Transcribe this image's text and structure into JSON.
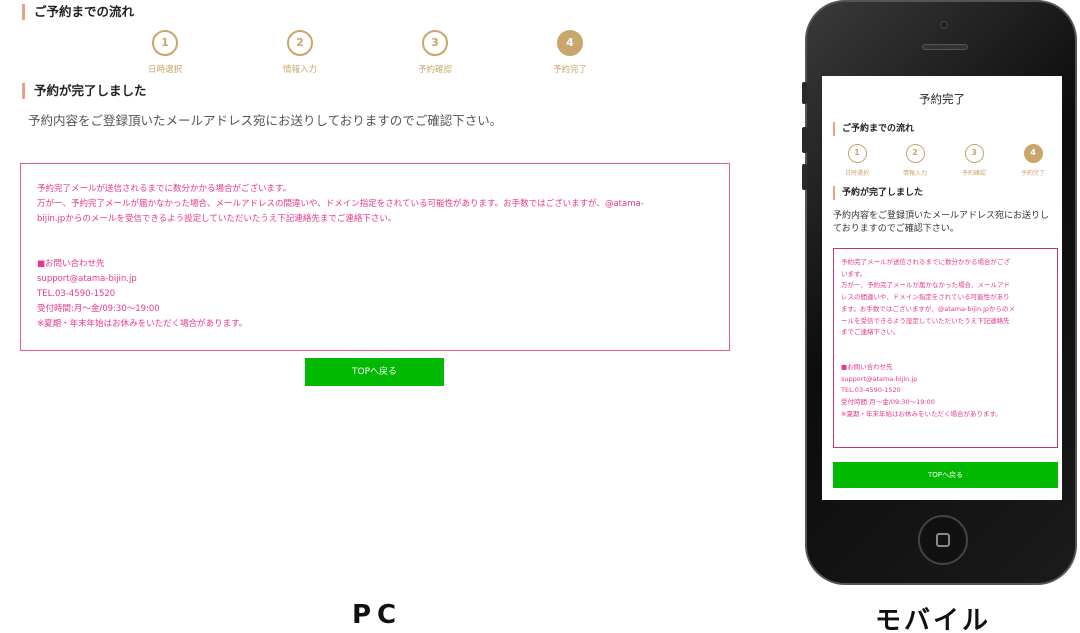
{
  "steps": [
    {
      "number": "1",
      "label": "日時選択",
      "active": false
    },
    {
      "number": "2",
      "label": "情報入力",
      "active": false
    },
    {
      "number": "3",
      "label": "予約確認",
      "active": false
    },
    {
      "number": "4",
      "label": "予約完了",
      "active": true
    }
  ],
  "pc": {
    "flow_heading": "ご予約までの流れ",
    "complete_heading": "予約が完了しました",
    "description": "予約内容をご登録頂いたメールアドレス宛にお送りしておりますのでご確認下さい。",
    "notice_lines": [
      "予約完了メールが送信されるまでに数分かかる場合がございます。",
      "万が一、予約完了メールが届かなかった場合、メールアドレスの間違いや、ドメイン指定をされている可能性があります。お手数ではございますが、@atama-",
      "bijin.jpからのメールを受信できるよう設定していただいたうえ下記連絡先までご連絡下さい。"
    ],
    "contact_lines": [
      "■お問い合わせ先",
      "support@atama-bijin.jp",
      "TEL.03-4590-1520",
      "受付時間:月〜金/09:30〜19:00",
      "※夏期・年末年始はお休みをいただく場合があります。"
    ],
    "top_button": "TOPへ戻る",
    "caption": "PC"
  },
  "mobile": {
    "page_title": "予約完了",
    "flow_heading": "ご予約までの流れ",
    "complete_heading": "予約が完了しました",
    "description_lines": [
      "予約内容をご登録頂いたメールアドレス宛にお送りし",
      "ておりますのでご確認下さい。"
    ],
    "notice_lines": [
      "予約完了メールが送信されるまでに数分かかる場合がござ",
      "います。",
      "万が一、予約完了メールが届かなかった場合、メールアド",
      "レスの間違いや、ドメイン指定をされている可能性があり",
      "ます。お手数ではございますが、@atama-bijin.jpからのメ",
      "ールを受信できるよう設定していただいたうえ下記連絡先",
      "までご連絡下さい。"
    ],
    "contact_lines": [
      "■お問い合わせ先",
      "support@atama-bijin.jp",
      "TEL.03-4590-1520",
      "受付時間:月〜金/09:30〜19:00",
      "※夏期・年末年始はお休みをいただく場合があります。"
    ],
    "top_button": "TOPへ戻る",
    "caption": "モバイル"
  },
  "colors": {
    "accent_gold": "#c9a66b",
    "heading_bar": "#e8a08a",
    "notice_pink": "#e8378c",
    "button_green": "#00b900"
  }
}
